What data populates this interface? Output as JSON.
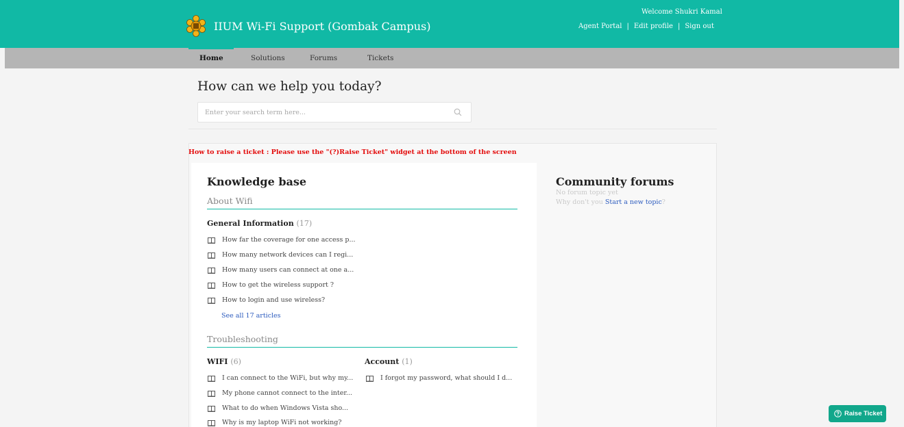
{
  "header": {
    "site_title": "IIUM Wi-Fi Support (Gombak Campus)",
    "welcome": "Welcome Shukri Kamal",
    "links": [
      "Agent Portal",
      "Edit profile",
      "Sign out"
    ],
    "separator": "|"
  },
  "nav": {
    "tabs": [
      "Home",
      "Solutions",
      "Forums",
      "Tickets"
    ],
    "active": "Home"
  },
  "hero": {
    "title": "How can we help you today?",
    "search_placeholder": "Enter your search term here...",
    "search_icon": "search-icon"
  },
  "notice": "How to raise a ticket : Please use the \"(?)Raise Ticket\" widget at the bottom of the screen",
  "knowledge_base": {
    "title": "Knowledge base",
    "sections": [
      {
        "title": "About Wifi",
        "folders": [
          {
            "name": "General Information",
            "count": "(17)",
            "articles": [
              "How far the coverage for one access p...",
              "How many network devices can I regi...",
              "How many users can connect at one a...",
              "How to get the wireless support ?",
              "How to login and use wireless?"
            ],
            "see_all": "See all 17 articles"
          }
        ]
      },
      {
        "title": "Troubleshooting",
        "folders": [
          {
            "name": "WIFI",
            "count": "(6)",
            "articles": [
              "I can connect to the WiFi, but why my...",
              "My phone cannot connect to the inter...",
              "What to do when Windows Vista sho...",
              "Why is my laptop WiFi not working?"
            ]
          },
          {
            "name": "Account",
            "count": "(1)",
            "articles": [
              "I forgot my password, what should I d..."
            ]
          }
        ]
      }
    ]
  },
  "forums": {
    "title": "Community forums",
    "empty": "No forum topic yet",
    "prompt_prefix": "Why don't you",
    "prompt_link": "Start a new topic",
    "prompt_suffix": "?"
  },
  "widget": {
    "label": "Raise Ticket",
    "icon": "question-circle-icon"
  },
  "colors": {
    "brand": "#11b9a5",
    "nav_bg": "#b5b5b5",
    "notice": "#e30b0b",
    "link": "#2c5bbe",
    "widget": "#11a78b"
  }
}
